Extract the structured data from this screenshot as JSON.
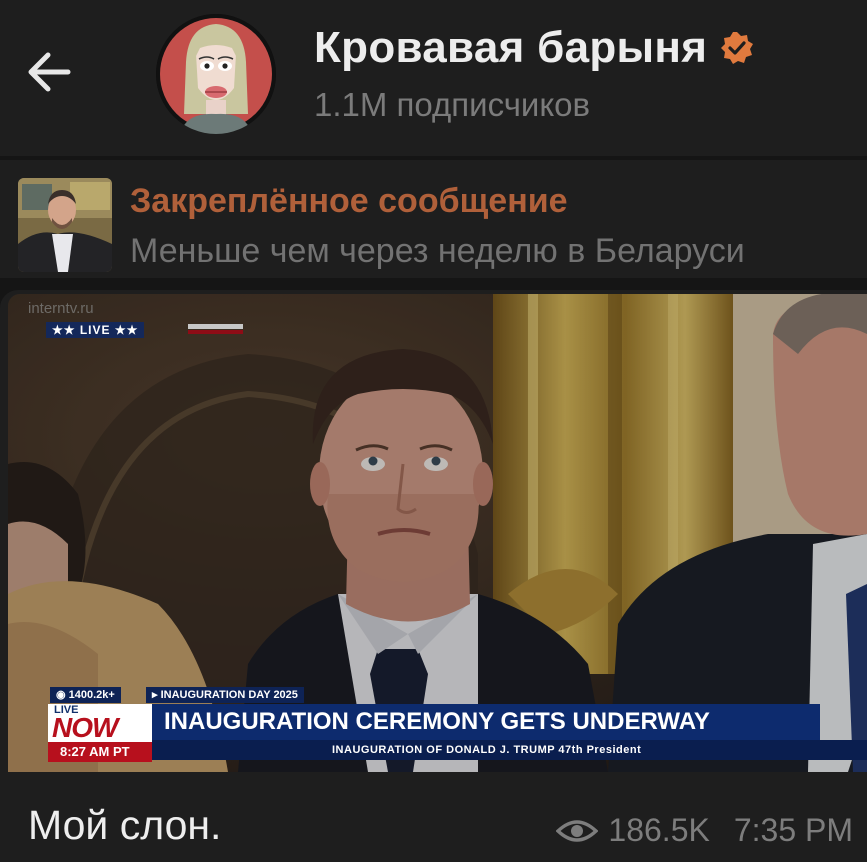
{
  "header": {
    "back_icon": "arrow-left-icon",
    "channel_name": "Кровавая барыня",
    "subscribers": "1.1M подписчиков",
    "verified_icon": "verified-badge-icon",
    "accent_color": "#e07a3e"
  },
  "pinned": {
    "title": "Закреплённое сообщение",
    "text": "Меньше чем через неделю в Беларуси",
    "title_color": "#b0603a"
  },
  "message": {
    "caption": "Мой слон.",
    "views": "186.5K",
    "time": "7:35 PM",
    "views_icon": "eye-icon",
    "media": {
      "watermark": "interntv.ru",
      "live_label": "★★ LIVE ★★",
      "views_badge": "◉ 1400.2k+",
      "event_badge": "▸ INAUGURATION DAY 2025",
      "now_live": "LIVE",
      "now_label": "NOW",
      "now_time": "8:27 AM PT",
      "headline": "INAUGURATION CEREMONY GETS UNDERWAY",
      "subline": "INAUGURATION OF DONALD J. TRUMP  47th President"
    }
  }
}
